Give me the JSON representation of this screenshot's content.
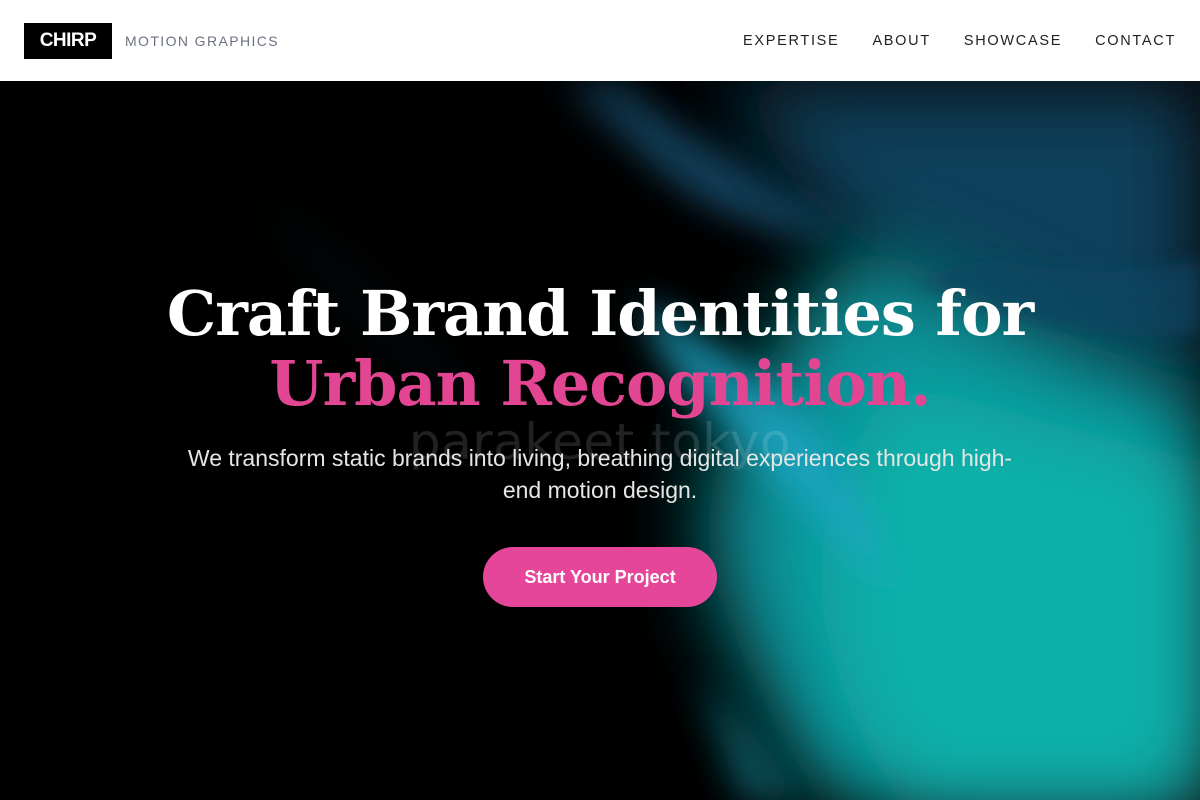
{
  "header": {
    "logo": "CHIRP",
    "tagline": "MOTION GRAPHICS",
    "nav": [
      "EXPERTISE",
      "ABOUT",
      "SHOWCASE",
      "CONTACT"
    ]
  },
  "hero": {
    "headline_line1": "Craft Brand Identities for",
    "headline_line2": "Urban Recognition.",
    "subtitle": "We transform static brands into living, breathing digital experiences through high-end motion design.",
    "cta_label": "Start Your Project",
    "watermark": "parakeet tokyo"
  },
  "colors": {
    "accent": "#e5469a",
    "background": "#000000",
    "teal": "#0aa3a0",
    "header_bg": "#ffffff"
  }
}
